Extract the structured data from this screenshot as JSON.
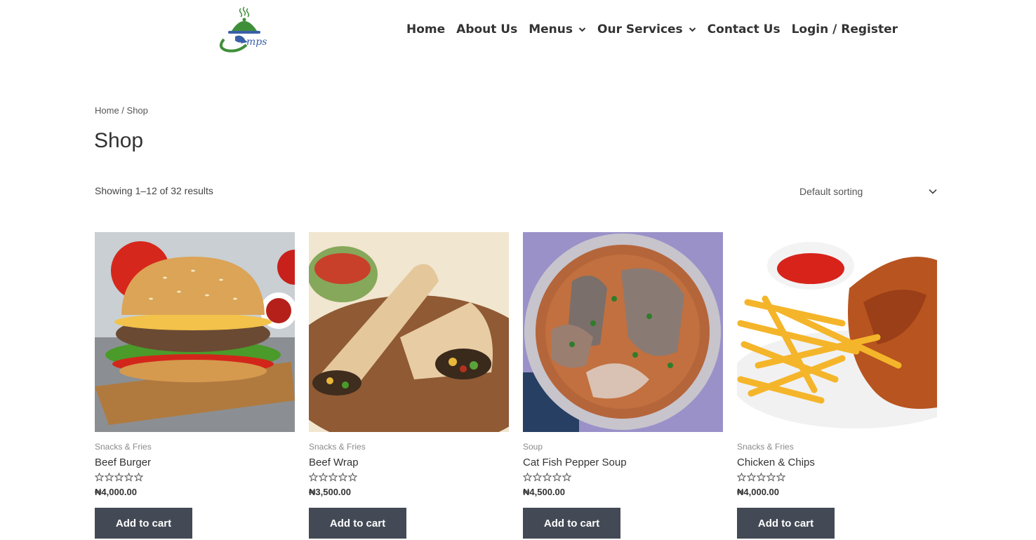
{
  "header": {
    "logo_text": "mps",
    "nav": [
      {
        "label": "Home"
      },
      {
        "label": "About Us"
      },
      {
        "label": "Menus"
      },
      {
        "label": "Our Services"
      },
      {
        "label": "Contact Us"
      },
      {
        "label": "Login / Register"
      }
    ]
  },
  "breadcrumb": {
    "home": "Home",
    "separator": " / ",
    "current": "Shop"
  },
  "page_title": "Shop",
  "result_count": "Showing 1–12 of 32 results",
  "sorting": {
    "selected": "Default sorting",
    "icon": "chevron-down-icon"
  },
  "currency_symbol": "₦",
  "products": [
    {
      "category": "Snacks & Fries",
      "name": "Beef Burger",
      "price": "₦4,000.00",
      "rating": 0,
      "button": "Add to cart",
      "image": "beef-burger-photo"
    },
    {
      "category": "Snacks & Fries",
      "name": "Beef Wrap",
      "price": "₦3,500.00",
      "rating": 0,
      "button": "Add to cart",
      "image": "beef-wrap-photo"
    },
    {
      "category": "Soup",
      "name": "Cat Fish Pepper Soup",
      "price": "₦4,500.00",
      "rating": 0,
      "button": "Add to cart",
      "image": "pepper-soup-photo"
    },
    {
      "category": "Snacks & Fries",
      "name": "Chicken & Chips",
      "price": "₦4,000.00",
      "rating": 0,
      "button": "Add to cart",
      "image": "chicken-chips-photo"
    }
  ],
  "colors": {
    "button_bg": "#434a55",
    "logo_green": "#3f8f3a",
    "logo_blue": "#3a5fa8"
  }
}
